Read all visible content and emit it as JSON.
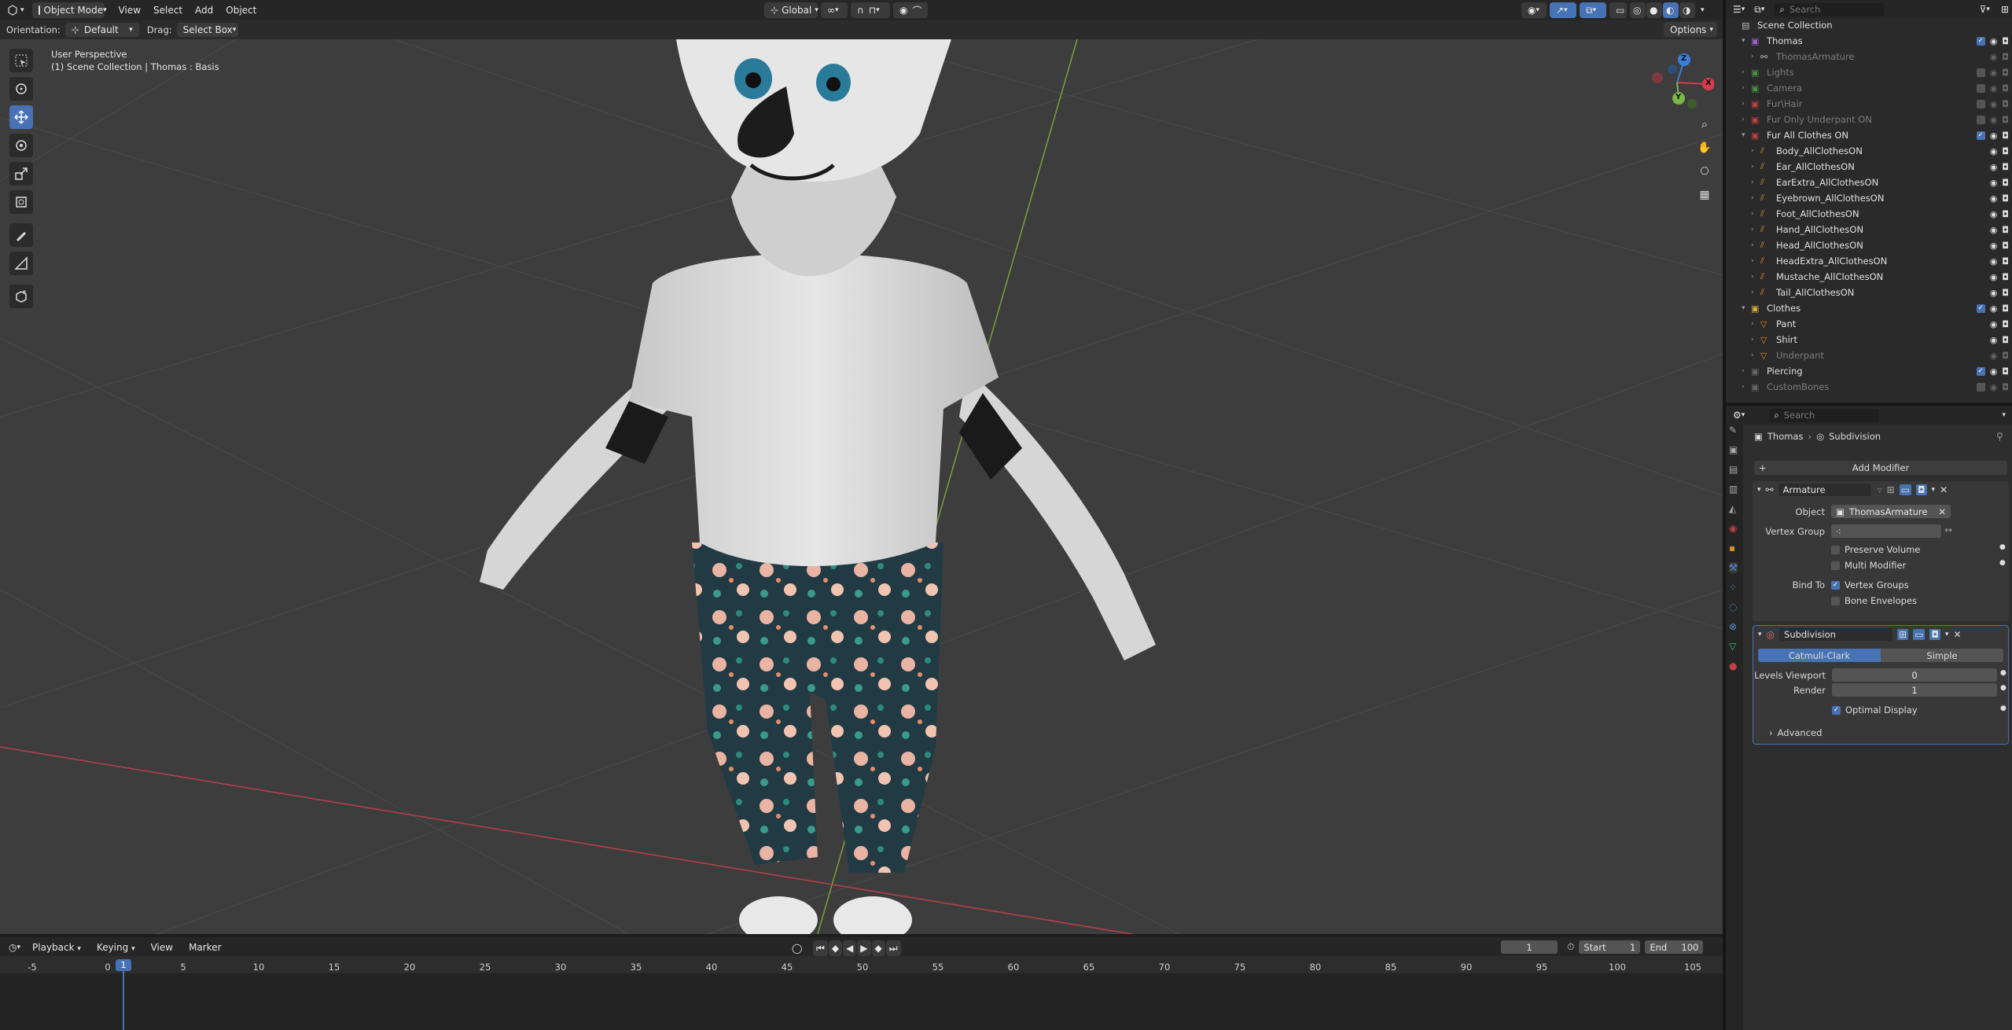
{
  "header": {
    "mode": "Object Mode",
    "menus": [
      "View",
      "Select",
      "Add",
      "Object"
    ],
    "transform_orientation": "Global",
    "search_placeholder": "Search",
    "options_label": "Options"
  },
  "tool_settings": {
    "orientation_label": "Orientation:",
    "orientation_value": "Default",
    "drag_label": "Drag:",
    "drag_value": "Select Box"
  },
  "viewport": {
    "perspective": "User Perspective",
    "collection_path": "(1) Scene Collection | Thomas : Basis",
    "gizmo": {
      "z": "Z",
      "y": "Y",
      "x": "X"
    }
  },
  "outliner": {
    "search_placeholder": "Search",
    "items": [
      {
        "label": "Scene Collection",
        "depth": 0,
        "type": "scene",
        "dim": false
      },
      {
        "label": "Thomas",
        "depth": 1,
        "type": "collection",
        "dim": false
      },
      {
        "label": "ThomasArmature",
        "depth": 2,
        "type": "armature",
        "dim": true
      },
      {
        "label": "Lights",
        "depth": 1,
        "type": "collection",
        "dim": true
      },
      {
        "label": "Camera",
        "depth": 1,
        "type": "collection",
        "dim": true
      },
      {
        "label": "Fur\\Hair",
        "depth": 1,
        "type": "collection",
        "dim": true
      },
      {
        "label": "Fur Only Underpant ON",
        "depth": 1,
        "type": "collection",
        "dim": true
      },
      {
        "label": "Fur All Clothes ON",
        "depth": 1,
        "type": "collection",
        "dim": false
      },
      {
        "label": "Body_AllClothesON",
        "depth": 2,
        "type": "curves",
        "dim": false
      },
      {
        "label": "Ear_AllClothesON",
        "depth": 2,
        "type": "curves",
        "dim": false
      },
      {
        "label": "EarExtra_AllClothesON",
        "depth": 2,
        "type": "curves",
        "dim": false
      },
      {
        "label": "Eyebrown_AllClothesON",
        "depth": 2,
        "type": "curves",
        "dim": false
      },
      {
        "label": "Foot_AllClothesON",
        "depth": 2,
        "type": "curves",
        "dim": false
      },
      {
        "label": "Hand_AllClothesON",
        "depth": 2,
        "type": "curves",
        "dim": false
      },
      {
        "label": "Head_AllClothesON",
        "depth": 2,
        "type": "curves",
        "dim": false
      },
      {
        "label": "HeadExtra_AllClothesON",
        "depth": 2,
        "type": "curves",
        "dim": false
      },
      {
        "label": "Mustache_AllClothesON",
        "depth": 2,
        "type": "curves",
        "dim": false
      },
      {
        "label": "Tail_AllClothesON",
        "depth": 2,
        "type": "curves",
        "dim": false
      },
      {
        "label": "Clothes",
        "depth": 1,
        "type": "collection",
        "dim": false
      },
      {
        "label": "Pant",
        "depth": 2,
        "type": "mesh",
        "dim": false
      },
      {
        "label": "Shirt",
        "depth": 2,
        "type": "mesh",
        "dim": false
      },
      {
        "label": "Underpant",
        "depth": 2,
        "type": "mesh",
        "dim": true
      },
      {
        "label": "Piercing",
        "depth": 1,
        "type": "collection",
        "dim": false
      },
      {
        "label": "CustomBones",
        "depth": 1,
        "type": "collection",
        "dim": true
      }
    ]
  },
  "properties": {
    "search_placeholder": "Search",
    "breadcrumb_object": "Thomas",
    "breadcrumb_modifier": "Subdivision",
    "add_modifier": "Add Modifier",
    "armature": {
      "name": "Armature",
      "object_label": "Object",
      "object_value": "ThomasArmature",
      "vertex_group_label": "Vertex Group",
      "preserve_volume": "Preserve Volume",
      "multi_modifier": "Multi Modifier",
      "bind_to_label": "Bind To",
      "vertex_groups": "Vertex Groups",
      "bone_envelopes": "Bone Envelopes"
    },
    "subdivision": {
      "name": "Subdivision",
      "catmull": "Catmull-Clark",
      "simple": "Simple",
      "levels_label": "Levels Viewport",
      "levels_value": "0",
      "render_label": "Render",
      "render_value": "1",
      "optimal_display": "Optimal Display",
      "advanced": "Advanced"
    }
  },
  "timeline": {
    "menus": [
      "Playback",
      "Keying",
      "View",
      "Marker"
    ],
    "current_frame": "1",
    "start_label": "Start",
    "start_value": "1",
    "end_label": "End",
    "end_value": "100",
    "ticks": [
      "-5",
      "0",
      "5",
      "10",
      "15",
      "20",
      "25",
      "30",
      "35",
      "40",
      "45",
      "50",
      "55",
      "60",
      "65",
      "70",
      "75",
      "80",
      "85",
      "90",
      "95",
      "100",
      "105"
    ],
    "playhead": "1"
  },
  "colors": {
    "accent": "#4772b3",
    "viewport_bg": "#3d3d3d",
    "panel_bg": "#303030",
    "header_bg": "#262626"
  }
}
